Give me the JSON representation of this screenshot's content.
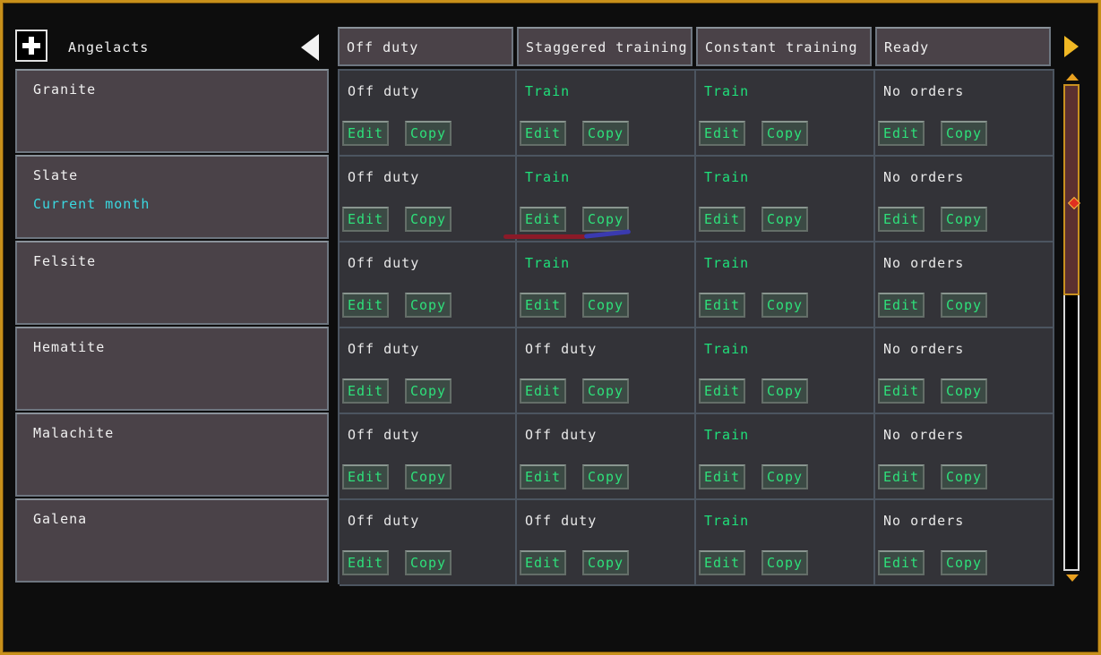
{
  "toolbar": {
    "squad_title": "Angelacts",
    "add_icon": "plus-icon",
    "prev_icon": "triangle-left-icon",
    "next_icon": "triangle-right-icon"
  },
  "columns": [
    "Off duty",
    "Staggered training",
    "Constant training",
    "Ready"
  ],
  "buttons": {
    "edit": "Edit",
    "copy": "Copy"
  },
  "colors": {
    "accent": "#c8901a",
    "status_green": "#1fe07a",
    "subtitle_cyan": "#3ad8e0",
    "panel": "#4a4248",
    "cell": "#333338"
  },
  "squads": [
    {
      "name": "Granite",
      "sub": "",
      "cells": [
        "Off duty",
        "Train",
        "Train",
        "No orders"
      ]
    },
    {
      "name": "Slate",
      "sub": "Current month",
      "cells": [
        "Off duty",
        "Train",
        "Train",
        "No orders"
      ]
    },
    {
      "name": "Felsite",
      "sub": "",
      "cells": [
        "Off duty",
        "Train",
        "Train",
        "No orders"
      ]
    },
    {
      "name": "Hematite",
      "sub": "",
      "cells": [
        "Off duty",
        "Off duty",
        "Train",
        "No orders"
      ]
    },
    {
      "name": "Malachite",
      "sub": "",
      "cells": [
        "Off duty",
        "Off duty",
        "Train",
        "No orders"
      ]
    },
    {
      "name": "Galena",
      "sub": "",
      "cells": [
        "Off duty",
        "Off duty",
        "Train",
        "No orders"
      ]
    }
  ]
}
